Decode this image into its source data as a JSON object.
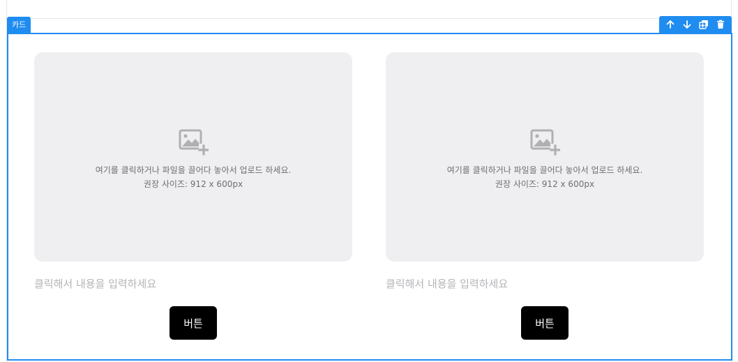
{
  "block": {
    "tag_label": "카드",
    "toolbar": [
      {
        "icon": "arrow-up-icon",
        "action": "move-up"
      },
      {
        "icon": "arrow-down-icon",
        "action": "move-down"
      },
      {
        "icon": "duplicate-icon",
        "action": "duplicate"
      },
      {
        "icon": "trash-icon",
        "action": "delete"
      }
    ],
    "accent_color": "#1f8cf0"
  },
  "cards": [
    {
      "upload": {
        "icon": "image-add-icon",
        "instruction": "여기를 클릭하거나 파일을 끌어다 놓아서 업로드 하세요.",
        "size_hint": "권장 사이즈: 912 x 600px"
      },
      "text_placeholder": "클릭해서 내용을 입력하세요",
      "button_label": "버튼"
    },
    {
      "upload": {
        "icon": "image-add-icon",
        "instruction": "여기를 클릭하거나 파일을 끌어다 놓아서 업로드 하세요.",
        "size_hint": "권장 사이즈: 912 x 600px"
      },
      "text_placeholder": "클릭해서 내용을 입력하세요",
      "button_label": "버튼"
    }
  ]
}
